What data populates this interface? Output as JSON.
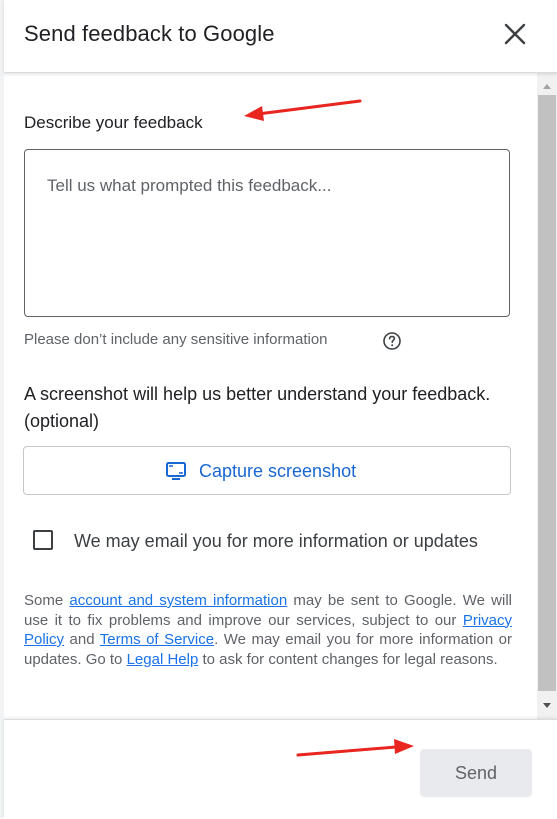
{
  "dialog": {
    "title": "Send feedback to Google",
    "close_icon": "close-icon"
  },
  "form": {
    "description_label": "Describe your feedback",
    "textarea_placeholder": "Tell us what prompted this feedback...",
    "hint": "Please don’t include any sensitive information",
    "hint_icon": "help-circle-icon",
    "screenshot_prompt": "A screenshot will help us better understand your feedback. (optional)",
    "capture_label": "Capture screenshot",
    "capture_icon": "screenshot-icon",
    "email_checkbox_label": "We may email you for more information or updates",
    "email_checkbox_checked": false
  },
  "legal": {
    "t1": "Some ",
    "link_account": "account and system information",
    "t2": " may be sent to Google. We will use it to fix problems and improve our services, subject to our ",
    "link_privacy": "Privacy Policy",
    "t3": " and ",
    "link_terms": "Terms of Service",
    "t4": ". We may email you for more information or updates. Go to ",
    "link_legal_help": "Legal Help",
    "t5": " to ask for content changes for legal reasons."
  },
  "footer": {
    "send_label": "Send"
  },
  "colors": {
    "accent": "#1a73e8",
    "annotation_arrow": "#e8251f",
    "send_disabled_bg": "#e8eaed"
  }
}
